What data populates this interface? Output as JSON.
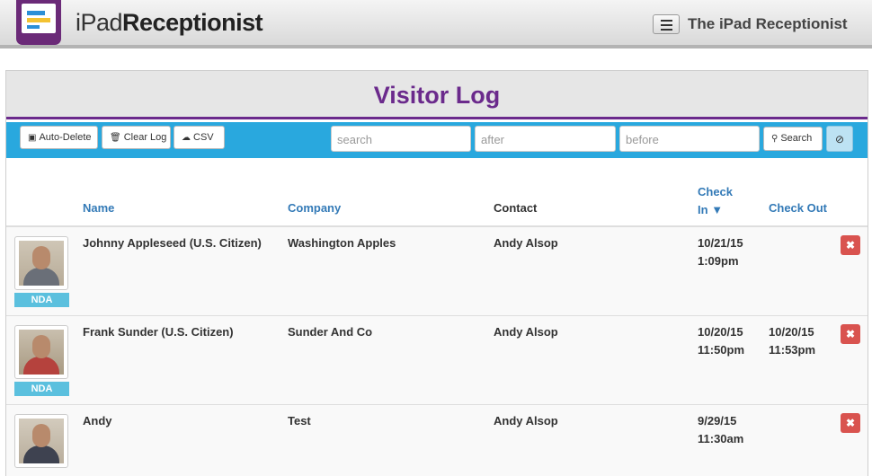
{
  "header": {
    "logo_light": "iPad",
    "logo_bold": "Receptionist",
    "app_title": "The iPad Receptionist"
  },
  "panel": {
    "title": "Visitor Log"
  },
  "toolbar": {
    "auto_delete": "Auto-Delete",
    "clear_log": "Clear Log",
    "csv": "CSV",
    "search_placeholder": "search",
    "after_placeholder": "after",
    "before_placeholder": "before",
    "search_button": "Search"
  },
  "columns": {
    "name": "Name",
    "company": "Company",
    "contact": "Contact",
    "check_in_1": "Check",
    "check_in_2": "In",
    "check_out": "Check Out"
  },
  "rows": [
    {
      "name": "Johnny Appleseed (U.S. Citizen)",
      "company": "Washington Apples",
      "contact": "Andy Alsop",
      "check_in_date": "10/21/15",
      "check_in_time": "1:09pm",
      "check_out_date": "",
      "check_out_time": "",
      "badge": "NDA"
    },
    {
      "name": "Frank Sunder (U.S. Citizen)",
      "company": "Sunder And Co",
      "contact": "Andy Alsop",
      "check_in_date": "10/20/15",
      "check_in_time": "11:50pm",
      "check_out_date": "10/20/15",
      "check_out_time": "11:53pm",
      "badge": "NDA"
    },
    {
      "name": "Andy",
      "company": "Test",
      "contact": "Andy Alsop",
      "check_in_date": "9/29/15",
      "check_in_time": "11:30am",
      "check_out_date": "",
      "check_out_time": "",
      "badge": ""
    }
  ],
  "colors": {
    "brand_purple": "#6b2a8c",
    "toolbar_blue": "#29a8de",
    "link_blue": "#337ab7",
    "danger_red": "#d9534f",
    "badge_blue": "#5bc0de"
  }
}
